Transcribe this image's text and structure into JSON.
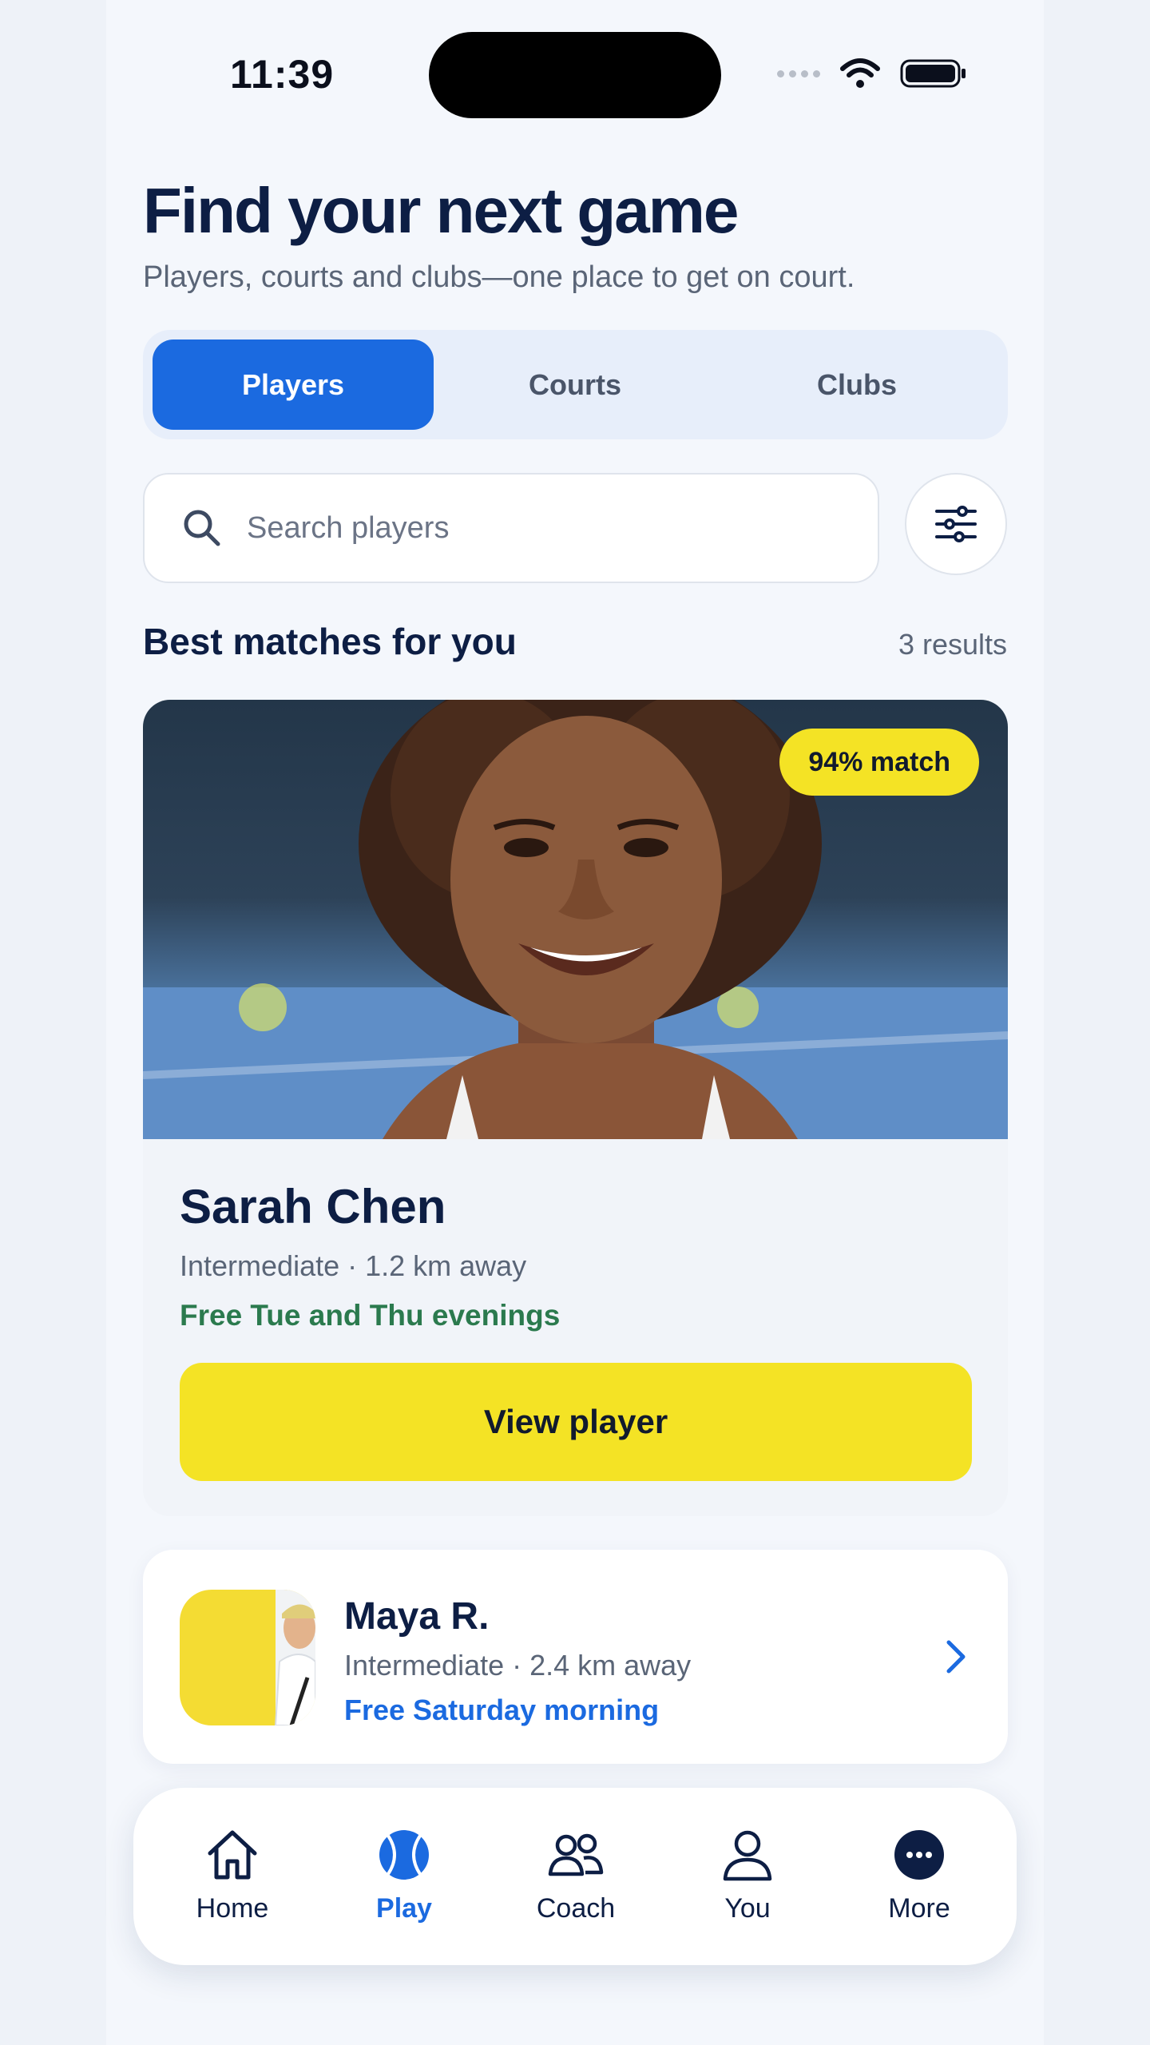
{
  "status": {
    "time": "11:39"
  },
  "header": {
    "title": "Find your next game",
    "subtitle": "Players, courts and clubs—one place to get on court."
  },
  "segments": [
    "Players",
    "Courts",
    "Clubs"
  ],
  "active_segment": "Players",
  "search": {
    "placeholder": "Search players"
  },
  "section": {
    "title": "Best matches for you",
    "count": "3 results"
  },
  "featured_player": {
    "match": "94% match",
    "name": "Sarah Chen",
    "meta": "Intermediate · 1.2 km away",
    "availability": "Free Tue and Thu evenings",
    "button": "View player"
  },
  "second_player": {
    "name": "Maya R.",
    "meta": "Intermediate · 2.4 km away",
    "availability": "Free Saturday morning"
  },
  "tabs": [
    {
      "label": "Home",
      "icon": "home-icon"
    },
    {
      "label": "Play",
      "icon": "tennis-ball-icon"
    },
    {
      "label": "Coach",
      "icon": "people-icon"
    },
    {
      "label": "You",
      "icon": "person-icon"
    },
    {
      "label": "More",
      "icon": "more-icon"
    }
  ],
  "active_tab": "Play",
  "colors": {
    "accent": "#1b6ae0",
    "highlight": "#f4e325",
    "available_green": "#2b7a4e",
    "text_primary": "#0d1e44"
  }
}
